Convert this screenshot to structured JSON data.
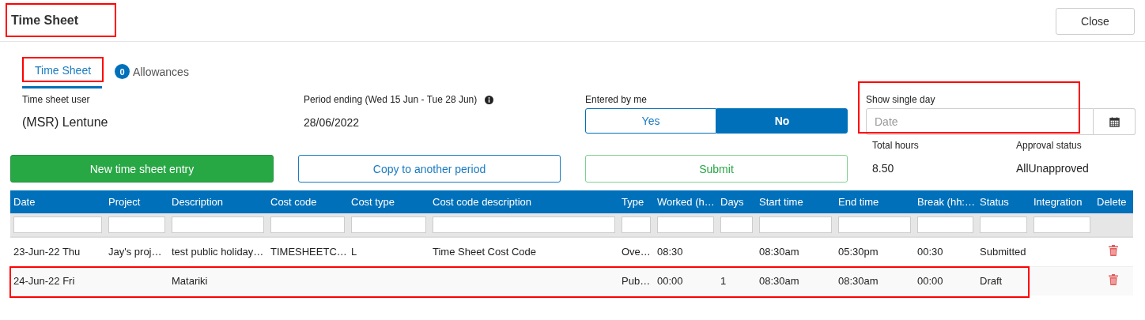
{
  "header": {
    "title": "Time Sheet",
    "highlighted": true,
    "close_button": "Close"
  },
  "tabs": [
    {
      "label": "Time Sheet",
      "selected": true,
      "highlighted": true
    },
    {
      "label": "Allowances",
      "badge": "0",
      "selected": false,
      "highlighted": false
    }
  ],
  "time_sheet_user": {
    "label": "Time sheet user",
    "value": "(MSR) Lentune"
  },
  "period_ending": {
    "label": "Period ending (Wed 15 Jun - Tue 28 Jun)",
    "value": "28/06/2022"
  },
  "entered_by_me": {
    "label": "Entered by me",
    "options": [
      {
        "label": "Yes",
        "selected": false
      },
      {
        "label": "No",
        "selected": true
      }
    ]
  },
  "show_single_day": {
    "label": "Show single day",
    "placeholder": "Date",
    "highlighted": true
  },
  "buttons": [
    {
      "label": "New time sheet entry",
      "kind": "primary"
    },
    {
      "label": "Copy to another period",
      "kind": "outline"
    },
    {
      "label": "Submit",
      "kind": "success-outline"
    }
  ],
  "totals": [
    {
      "label": "Total hours",
      "value": "8.50"
    },
    {
      "label": "Approval status",
      "value": "AllUnapproved"
    }
  ],
  "table": {
    "columns": [
      {
        "label": "Date",
        "filter": true
      },
      {
        "label": "Project",
        "filter": true
      },
      {
        "label": "Description",
        "filter": true
      },
      {
        "label": "Cost code",
        "filter": true
      },
      {
        "label": "Cost type",
        "filter": true
      },
      {
        "label": "Cost code description",
        "filter": true
      },
      {
        "label": "Type",
        "filter": true
      },
      {
        "label": "Worked (h…",
        "filter": true
      },
      {
        "label": "Days",
        "filter": true
      },
      {
        "label": "Start time",
        "filter": true
      },
      {
        "label": "End time",
        "filter": true
      },
      {
        "label": "Break (hh:…",
        "filter": true
      },
      {
        "label": "Status",
        "filter": true
      },
      {
        "label": "Integration",
        "filter": true
      },
      {
        "label": "Delete",
        "filter": false
      }
    ],
    "rows": [
      {
        "cells": [
          "23-Jun-22 Thu",
          "Jay's proj…",
          "test public holiday…",
          "TIMESHEETC…",
          "L",
          "Time Sheet Cost Code",
          "Ove…",
          "08:30",
          "",
          "08:30am",
          "05:30pm",
          "00:30",
          "Submitted",
          ""
        ],
        "highlighted": false
      },
      {
        "cells": [
          "24-Jun-22 Fri",
          "",
          "Matariki",
          "",
          "",
          "",
          "Pub…",
          "00:00",
          "1",
          "08:30am",
          "08:30am",
          "00:00",
          "Draft",
          ""
        ],
        "highlighted": true
      }
    ]
  }
}
